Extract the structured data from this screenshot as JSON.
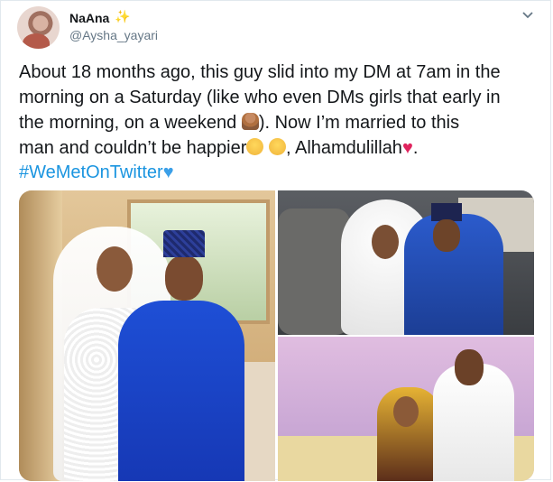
{
  "tweet": {
    "display_name": "NaAna",
    "sparkle_glyph": "✨",
    "handle": "@Aysha_yayari",
    "caret_icon": "chevron-down-icon",
    "text_part1": "About 18 months ago, this guy slid into my DM at 7am in the\nmorning on a Saturday (like who even DMs girls that early in\nthe morning, on a weekend ",
    "text_part2": "). Now I’m married to this\nman and couldn’t be happier",
    "text_part3": ", Alhamdulillah",
    "text_part4": ".",
    "hashtag": "#WeMetOnTwitter",
    "emojis": [
      "woman-shrugging",
      "relieved-face",
      "pleading-face",
      "red-heart",
      "blue-heart"
    ]
  },
  "media": {
    "photos": [
      {
        "subject": "couple-standing-indoors"
      },
      {
        "subject": "couple-in-car"
      },
      {
        "subject": "couple-on-couch"
      }
    ]
  },
  "colors": {
    "hashtag": "#1b95e0",
    "secondary_text": "#657786",
    "heart": "#e0245e",
    "blue_heart": "#3b9fe8"
  }
}
